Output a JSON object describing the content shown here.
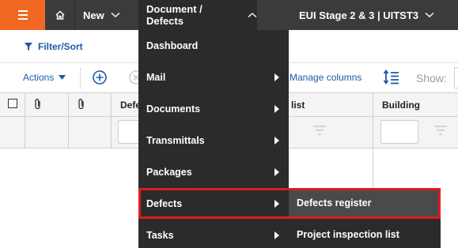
{
  "topbar": {
    "menu_icon": "hamburger-icon",
    "home_icon": "home-icon",
    "new_label": "New",
    "module_label": "Document / Defects",
    "project_label": "EUI Stage 2 & 3 | UITST3"
  },
  "filterbar": {
    "filter_label": "Filter/Sort",
    "filter_icon": "funnel-icon"
  },
  "toolbar": {
    "actions_label": "Actions",
    "add_icon": "plus-circle-icon",
    "remove_icon": "x-circle-icon",
    "manage_columns_label": "Manage columns",
    "sort_icon": "sort-order-icon",
    "show_label": "Show:"
  },
  "grid": {
    "columns": [
      "Defe",
      "list",
      "Building"
    ]
  },
  "menu": {
    "items": [
      {
        "label": "Dashboard"
      },
      {
        "label": "Mail"
      },
      {
        "label": "Documents"
      },
      {
        "label": "Transmittals"
      },
      {
        "label": "Packages"
      },
      {
        "label": "Defects"
      },
      {
        "label": "Tasks"
      }
    ],
    "submenu": [
      {
        "label": "Defects register"
      },
      {
        "label": "Project inspection list"
      }
    ]
  },
  "colors": {
    "accent": "#f26722",
    "topbar_bg": "#3b3b3b",
    "menu_bg": "#2b2b2b",
    "link": "#1a5aa8",
    "highlight_border": "#e01b1b"
  }
}
